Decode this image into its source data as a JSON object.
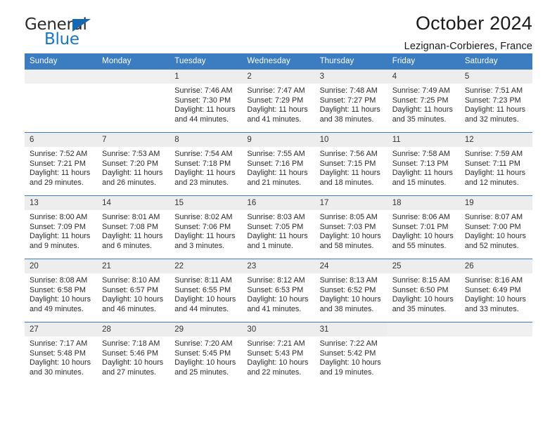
{
  "logo": {
    "word1": "General",
    "word2": "Blue",
    "triangle_icon": "blue-triangle-icon",
    "accent_color": "#1877c4"
  },
  "header": {
    "title": "October 2024",
    "location": "Lezignan-Corbieres, France"
  },
  "calendar": {
    "header_bg": "#3b7dc0",
    "weekdays": [
      "Sunday",
      "Monday",
      "Tuesday",
      "Wednesday",
      "Thursday",
      "Friday",
      "Saturday"
    ],
    "weeks": [
      [
        {
          "empty": true
        },
        {
          "empty": true
        },
        {
          "day": "1",
          "sunrise": "Sunrise: 7:46 AM",
          "sunset": "Sunset: 7:30 PM",
          "daylight1": "Daylight: 11 hours",
          "daylight2": "and 44 minutes."
        },
        {
          "day": "2",
          "sunrise": "Sunrise: 7:47 AM",
          "sunset": "Sunset: 7:29 PM",
          "daylight1": "Daylight: 11 hours",
          "daylight2": "and 41 minutes."
        },
        {
          "day": "3",
          "sunrise": "Sunrise: 7:48 AM",
          "sunset": "Sunset: 7:27 PM",
          "daylight1": "Daylight: 11 hours",
          "daylight2": "and 38 minutes."
        },
        {
          "day": "4",
          "sunrise": "Sunrise: 7:49 AM",
          "sunset": "Sunset: 7:25 PM",
          "daylight1": "Daylight: 11 hours",
          "daylight2": "and 35 minutes."
        },
        {
          "day": "5",
          "sunrise": "Sunrise: 7:51 AM",
          "sunset": "Sunset: 7:23 PM",
          "daylight1": "Daylight: 11 hours",
          "daylight2": "and 32 minutes."
        }
      ],
      [
        {
          "day": "6",
          "sunrise": "Sunrise: 7:52 AM",
          "sunset": "Sunset: 7:21 PM",
          "daylight1": "Daylight: 11 hours",
          "daylight2": "and 29 minutes."
        },
        {
          "day": "7",
          "sunrise": "Sunrise: 7:53 AM",
          "sunset": "Sunset: 7:20 PM",
          "daylight1": "Daylight: 11 hours",
          "daylight2": "and 26 minutes."
        },
        {
          "day": "8",
          "sunrise": "Sunrise: 7:54 AM",
          "sunset": "Sunset: 7:18 PM",
          "daylight1": "Daylight: 11 hours",
          "daylight2": "and 23 minutes."
        },
        {
          "day": "9",
          "sunrise": "Sunrise: 7:55 AM",
          "sunset": "Sunset: 7:16 PM",
          "daylight1": "Daylight: 11 hours",
          "daylight2": "and 21 minutes."
        },
        {
          "day": "10",
          "sunrise": "Sunrise: 7:56 AM",
          "sunset": "Sunset: 7:15 PM",
          "daylight1": "Daylight: 11 hours",
          "daylight2": "and 18 minutes."
        },
        {
          "day": "11",
          "sunrise": "Sunrise: 7:58 AM",
          "sunset": "Sunset: 7:13 PM",
          "daylight1": "Daylight: 11 hours",
          "daylight2": "and 15 minutes."
        },
        {
          "day": "12",
          "sunrise": "Sunrise: 7:59 AM",
          "sunset": "Sunset: 7:11 PM",
          "daylight1": "Daylight: 11 hours",
          "daylight2": "and 12 minutes."
        }
      ],
      [
        {
          "day": "13",
          "sunrise": "Sunrise: 8:00 AM",
          "sunset": "Sunset: 7:09 PM",
          "daylight1": "Daylight: 11 hours",
          "daylight2": "and 9 minutes."
        },
        {
          "day": "14",
          "sunrise": "Sunrise: 8:01 AM",
          "sunset": "Sunset: 7:08 PM",
          "daylight1": "Daylight: 11 hours",
          "daylight2": "and 6 minutes."
        },
        {
          "day": "15",
          "sunrise": "Sunrise: 8:02 AM",
          "sunset": "Sunset: 7:06 PM",
          "daylight1": "Daylight: 11 hours",
          "daylight2": "and 3 minutes."
        },
        {
          "day": "16",
          "sunrise": "Sunrise: 8:03 AM",
          "sunset": "Sunset: 7:05 PM",
          "daylight1": "Daylight: 11 hours",
          "daylight2": "and 1 minute."
        },
        {
          "day": "17",
          "sunrise": "Sunrise: 8:05 AM",
          "sunset": "Sunset: 7:03 PM",
          "daylight1": "Daylight: 10 hours",
          "daylight2": "and 58 minutes."
        },
        {
          "day": "18",
          "sunrise": "Sunrise: 8:06 AM",
          "sunset": "Sunset: 7:01 PM",
          "daylight1": "Daylight: 10 hours",
          "daylight2": "and 55 minutes."
        },
        {
          "day": "19",
          "sunrise": "Sunrise: 8:07 AM",
          "sunset": "Sunset: 7:00 PM",
          "daylight1": "Daylight: 10 hours",
          "daylight2": "and 52 minutes."
        }
      ],
      [
        {
          "day": "20",
          "sunrise": "Sunrise: 8:08 AM",
          "sunset": "Sunset: 6:58 PM",
          "daylight1": "Daylight: 10 hours",
          "daylight2": "and 49 minutes."
        },
        {
          "day": "21",
          "sunrise": "Sunrise: 8:10 AM",
          "sunset": "Sunset: 6:57 PM",
          "daylight1": "Daylight: 10 hours",
          "daylight2": "and 46 minutes."
        },
        {
          "day": "22",
          "sunrise": "Sunrise: 8:11 AM",
          "sunset": "Sunset: 6:55 PM",
          "daylight1": "Daylight: 10 hours",
          "daylight2": "and 44 minutes."
        },
        {
          "day": "23",
          "sunrise": "Sunrise: 8:12 AM",
          "sunset": "Sunset: 6:53 PM",
          "daylight1": "Daylight: 10 hours",
          "daylight2": "and 41 minutes."
        },
        {
          "day": "24",
          "sunrise": "Sunrise: 8:13 AM",
          "sunset": "Sunset: 6:52 PM",
          "daylight1": "Daylight: 10 hours",
          "daylight2": "and 38 minutes."
        },
        {
          "day": "25",
          "sunrise": "Sunrise: 8:15 AM",
          "sunset": "Sunset: 6:50 PM",
          "daylight1": "Daylight: 10 hours",
          "daylight2": "and 35 minutes."
        },
        {
          "day": "26",
          "sunrise": "Sunrise: 8:16 AM",
          "sunset": "Sunset: 6:49 PM",
          "daylight1": "Daylight: 10 hours",
          "daylight2": "and 33 minutes."
        }
      ],
      [
        {
          "day": "27",
          "sunrise": "Sunrise: 7:17 AM",
          "sunset": "Sunset: 5:48 PM",
          "daylight1": "Daylight: 10 hours",
          "daylight2": "and 30 minutes."
        },
        {
          "day": "28",
          "sunrise": "Sunrise: 7:18 AM",
          "sunset": "Sunset: 5:46 PM",
          "daylight1": "Daylight: 10 hours",
          "daylight2": "and 27 minutes."
        },
        {
          "day": "29",
          "sunrise": "Sunrise: 7:20 AM",
          "sunset": "Sunset: 5:45 PM",
          "daylight1": "Daylight: 10 hours",
          "daylight2": "and 25 minutes."
        },
        {
          "day": "30",
          "sunrise": "Sunrise: 7:21 AM",
          "sunset": "Sunset: 5:43 PM",
          "daylight1": "Daylight: 10 hours",
          "daylight2": "and 22 minutes."
        },
        {
          "day": "31",
          "sunrise": "Sunrise: 7:22 AM",
          "sunset": "Sunset: 5:42 PM",
          "daylight1": "Daylight: 10 hours",
          "daylight2": "and 19 minutes."
        },
        {
          "empty": true
        },
        {
          "empty": true
        }
      ]
    ]
  }
}
